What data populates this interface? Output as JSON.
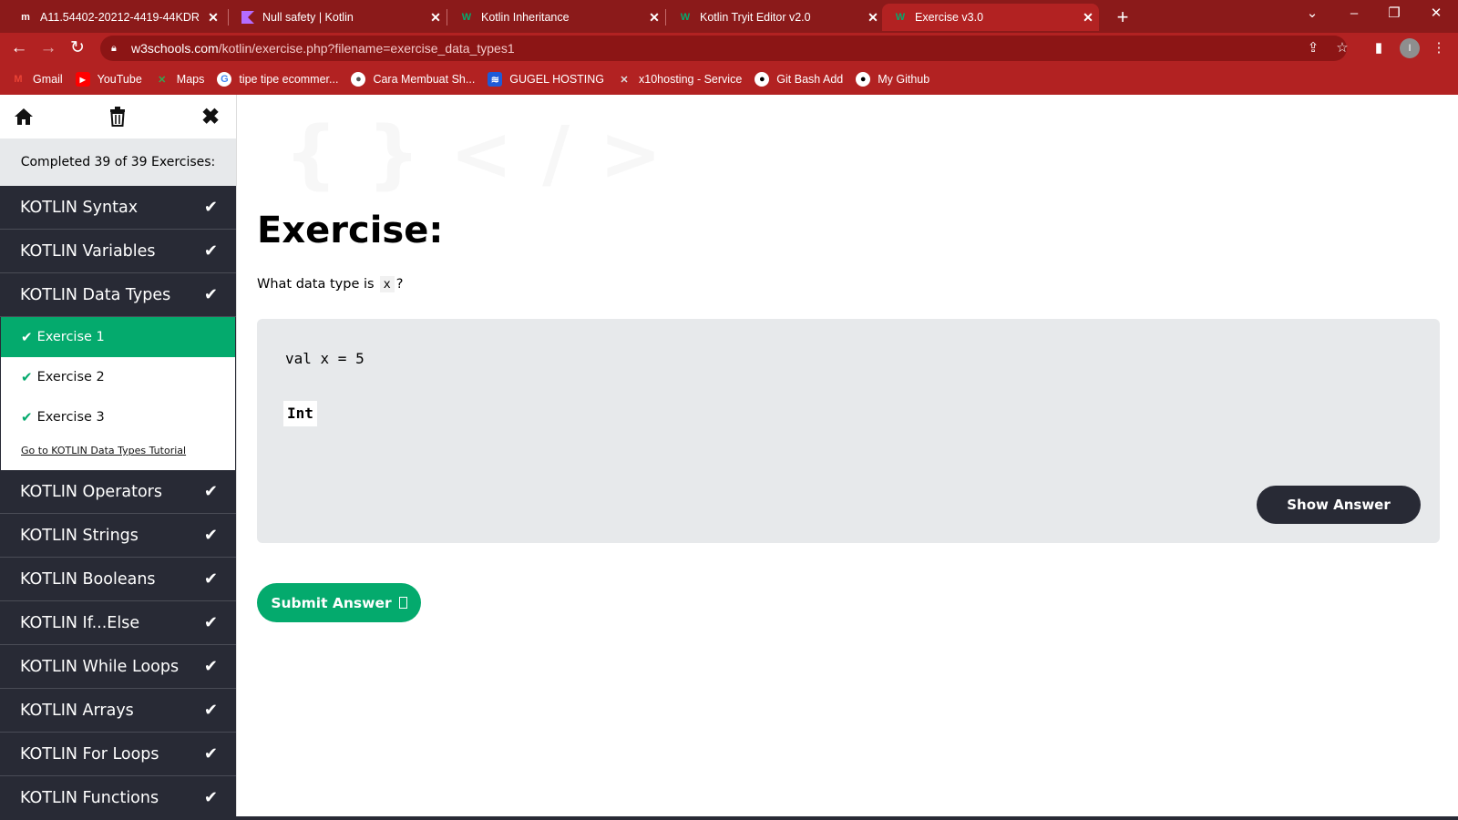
{
  "browser": {
    "tabs": [
      {
        "title": "A11.54402-20212-4419-44KDR",
        "favicon": "m-icon",
        "active": false
      },
      {
        "title": "Null safety | Kotlin",
        "favicon": "kotlin-icon",
        "active": false
      },
      {
        "title": "Kotlin Inheritance",
        "favicon": "w3schools-icon",
        "active": false
      },
      {
        "title": "Kotlin Tryit Editor v2.0",
        "favicon": "w3schools-icon",
        "active": false
      },
      {
        "title": "Exercise v3.0",
        "favicon": "w3schools-icon",
        "active": true
      }
    ],
    "url_host": "w3schools.com",
    "url_path": "/kotlin/exercise.php?filename=exercise_data_types1",
    "profile_initial": "I",
    "bookmarks": [
      {
        "label": "Gmail",
        "icon": "gmail-icon"
      },
      {
        "label": "YouTube",
        "icon": "youtube-icon"
      },
      {
        "label": "Maps",
        "icon": "maps-icon"
      },
      {
        "label": "tipe tipe ecommer...",
        "icon": "google-icon"
      },
      {
        "label": "Cara Membuat Sh...",
        "icon": "user-icon"
      },
      {
        "label": "GUGEL HOSTING",
        "icon": "hosting-icon"
      },
      {
        "label": "x10hosting - Service",
        "icon": "x10-icon"
      },
      {
        "label": "Git Bash Add",
        "icon": "github-icon"
      },
      {
        "label": "My Github",
        "icon": "github-icon"
      }
    ],
    "colors": {
      "tabbar": "#8b1a1a",
      "toolbar": "#b22222"
    }
  },
  "sidebar": {
    "completed_text": "Completed 39 of 39 Exercises:",
    "categories_before": [
      {
        "label": "KOTLIN Syntax"
      },
      {
        "label": "KOTLIN Variables"
      },
      {
        "label": "KOTLIN Data Types"
      }
    ],
    "exercises": [
      {
        "label": "Exercise 1",
        "active": true
      },
      {
        "label": "Exercise 2",
        "active": false
      },
      {
        "label": "Exercise 3",
        "active": false
      }
    ],
    "tutorial_link": "Go to KOTLIN Data Types Tutorial",
    "categories_after": [
      {
        "label": "KOTLIN Operators"
      },
      {
        "label": "KOTLIN Strings"
      },
      {
        "label": "KOTLIN Booleans"
      },
      {
        "label": "KOTLIN If...Else"
      },
      {
        "label": "KOTLIN While Loops"
      },
      {
        "label": "KOTLIN Arrays"
      },
      {
        "label": "KOTLIN For Loops"
      },
      {
        "label": "KOTLIN Functions"
      }
    ],
    "colors": {
      "dark": "#282a35",
      "active": "#04aa6d"
    }
  },
  "main": {
    "title": "Exercise:",
    "question_prefix": "What data type is",
    "question_code": "x",
    "question_suffix": "?",
    "code_line": "val x = 5",
    "answer_value": "Int",
    "show_answer_label": "Show Answer",
    "submit_label": "Submit Answer"
  }
}
